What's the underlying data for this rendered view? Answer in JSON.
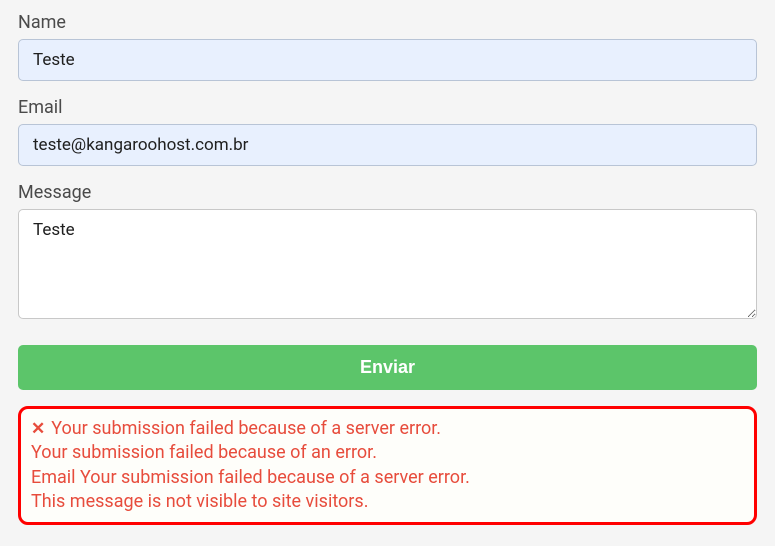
{
  "form": {
    "name": {
      "label": "Name",
      "value": "Teste"
    },
    "email": {
      "label": "Email",
      "value": "teste@kangaroohost.com.br"
    },
    "message": {
      "label": "Message",
      "value": "Teste"
    },
    "submit_label": "Enviar"
  },
  "error": {
    "line1": "Your submission failed because of a server error.",
    "line2": "Your submission failed because of an error.",
    "line3": "Email Your submission failed because of a server error.",
    "line4": "This message is not visible to site visitors."
  }
}
